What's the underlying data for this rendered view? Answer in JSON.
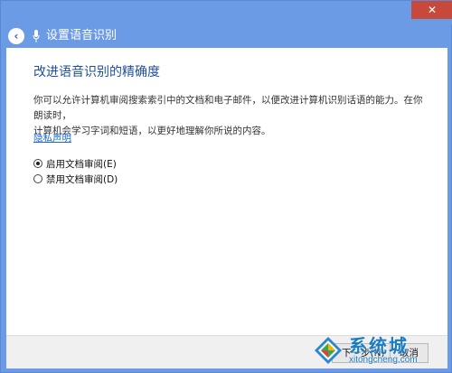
{
  "window": {
    "close_glyph": "✕"
  },
  "nav": {
    "back_glyph": "‹",
    "title": "设置语音识别"
  },
  "content": {
    "heading": "改进语音识别的精确度",
    "description_line1": "你可以允许计算机审阅搜索索引中的文档和电子邮件，以便改进计算机识别话语的能力。在你朗读时，",
    "description_line2": "计算机会学习字词和短语，以更好地理解你所说的内容。",
    "privacy_link": "隐私声明",
    "options": [
      {
        "label": "启用文档审阅(E)",
        "checked": true
      },
      {
        "label": "禁用文档审阅(D)",
        "checked": false
      }
    ]
  },
  "footer": {
    "next_label": "下一步(N)",
    "cancel_label": "取消"
  },
  "watermark": {
    "brand": "系统城",
    "url": "xitongcheng.com"
  },
  "colors": {
    "accent": "#6c9be6",
    "heading": "#1e4f9c",
    "link": "#1b6ad3",
    "close": "#c7493b"
  }
}
